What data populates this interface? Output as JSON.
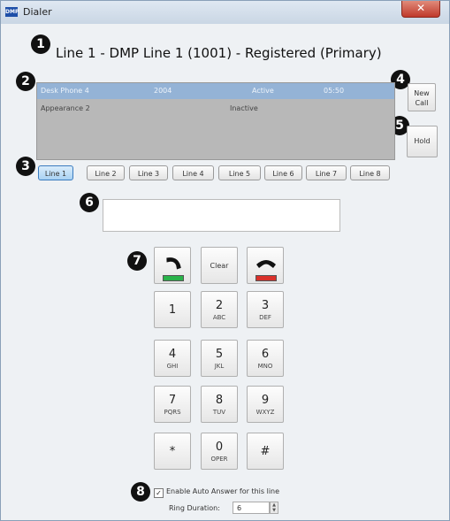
{
  "window": {
    "title": "Dialer",
    "app_icon": "DMP",
    "close_glyph": "✕"
  },
  "header": {
    "line_title": "Line 1 - DMP Line 1 (1001) - Registered (Primary)"
  },
  "markers": [
    "1",
    "2",
    "3",
    "4",
    "5",
    "6",
    "7",
    "8"
  ],
  "calls": [
    {
      "name": "Desk Phone 4",
      "number": "2004",
      "status": "Active",
      "time": "05:50",
      "selected": true
    },
    {
      "name": "Appearance 2",
      "number": "",
      "status": "Inactive",
      "time": "",
      "selected": false
    }
  ],
  "buttons": {
    "new_call": "New Call",
    "hold": "Hold",
    "clear": "Clear"
  },
  "lines": [
    "Line 1",
    "Line 2",
    "Line 3",
    "Line 4",
    "Line 5",
    "Line 6",
    "Line 7",
    "Line 8"
  ],
  "display_value": "",
  "keypad": [
    {
      "digit": "1",
      "letters": ""
    },
    {
      "digit": "2",
      "letters": "ABC"
    },
    {
      "digit": "3",
      "letters": "DEF"
    },
    {
      "digit": "4",
      "letters": "GHI"
    },
    {
      "digit": "5",
      "letters": "JKL"
    },
    {
      "digit": "6",
      "letters": "MNO"
    },
    {
      "digit": "7",
      "letters": "PQRS"
    },
    {
      "digit": "8",
      "letters": "TUV"
    },
    {
      "digit": "9",
      "letters": "WXYZ"
    },
    {
      "digit": "*",
      "letters": ""
    },
    {
      "digit": "0",
      "letters": "OPER"
    },
    {
      "digit": "#",
      "letters": ""
    }
  ],
  "auto_answer": {
    "label": "Enable Auto Answer for this line",
    "checked": "✓"
  },
  "ring_duration": {
    "label": "Ring Duration:",
    "value": "6"
  },
  "colors": {
    "answer": "#2ab34a",
    "hangup": "#d9302a",
    "selected_row": "#94b3d6",
    "active_tab": "#a9d2f3"
  }
}
